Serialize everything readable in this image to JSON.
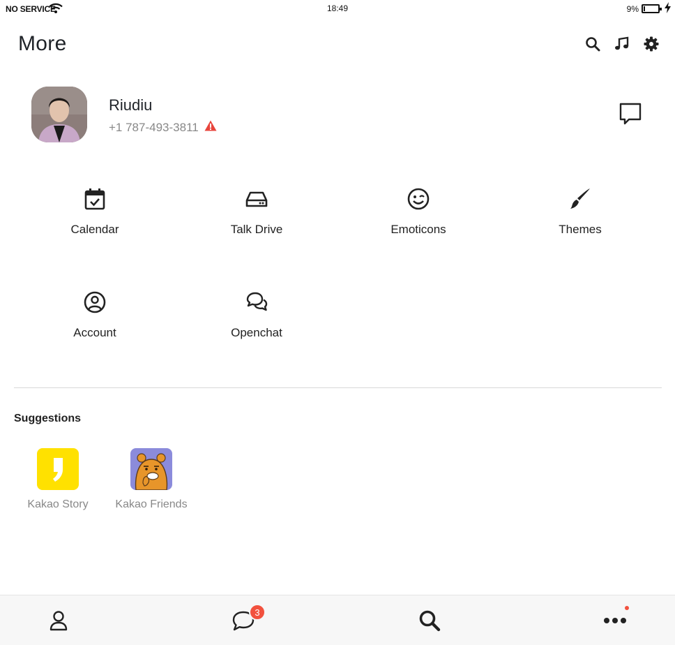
{
  "status_bar": {
    "carrier": "NO SERVICE",
    "time": "18:49",
    "battery_percent": "9%",
    "battery_level": 0.09
  },
  "header": {
    "title": "More",
    "icons": [
      "search-icon",
      "music-note-icon",
      "gear-icon"
    ]
  },
  "profile": {
    "name": "Riudiu",
    "phone": "+1 787-493-3811",
    "warning_icon": "warning-triangle-icon",
    "warning_color": "#e8453c"
  },
  "menu": {
    "items": [
      {
        "label": "Calendar",
        "icon": "calendar-check-icon"
      },
      {
        "label": "Talk Drive",
        "icon": "drive-icon"
      },
      {
        "label": "Emoticons",
        "icon": "wink-emoticon-icon"
      },
      {
        "label": "Themes",
        "icon": "paintbrush-icon"
      },
      {
        "label": "Account",
        "icon": "account-circle-icon"
      },
      {
        "label": "Openchat",
        "icon": "chat-bubbles-icon"
      }
    ]
  },
  "suggestions": {
    "title": "Suggestions",
    "items": [
      {
        "label": "Kakao Story",
        "icon": "kakao-story-icon",
        "color": "#ffe100"
      },
      {
        "label": "Kakao Friends",
        "icon": "kakao-friends-icon",
        "color": "#8b8bdb"
      }
    ]
  },
  "tab_bar": {
    "tabs": [
      {
        "name": "friends",
        "icon": "person-icon"
      },
      {
        "name": "chats",
        "icon": "chat-icon",
        "badge": "3"
      },
      {
        "name": "search",
        "icon": "search-icon"
      },
      {
        "name": "more",
        "icon": "more-dots-icon",
        "has_dot": true
      }
    ],
    "badge_color": "#f2513e"
  }
}
